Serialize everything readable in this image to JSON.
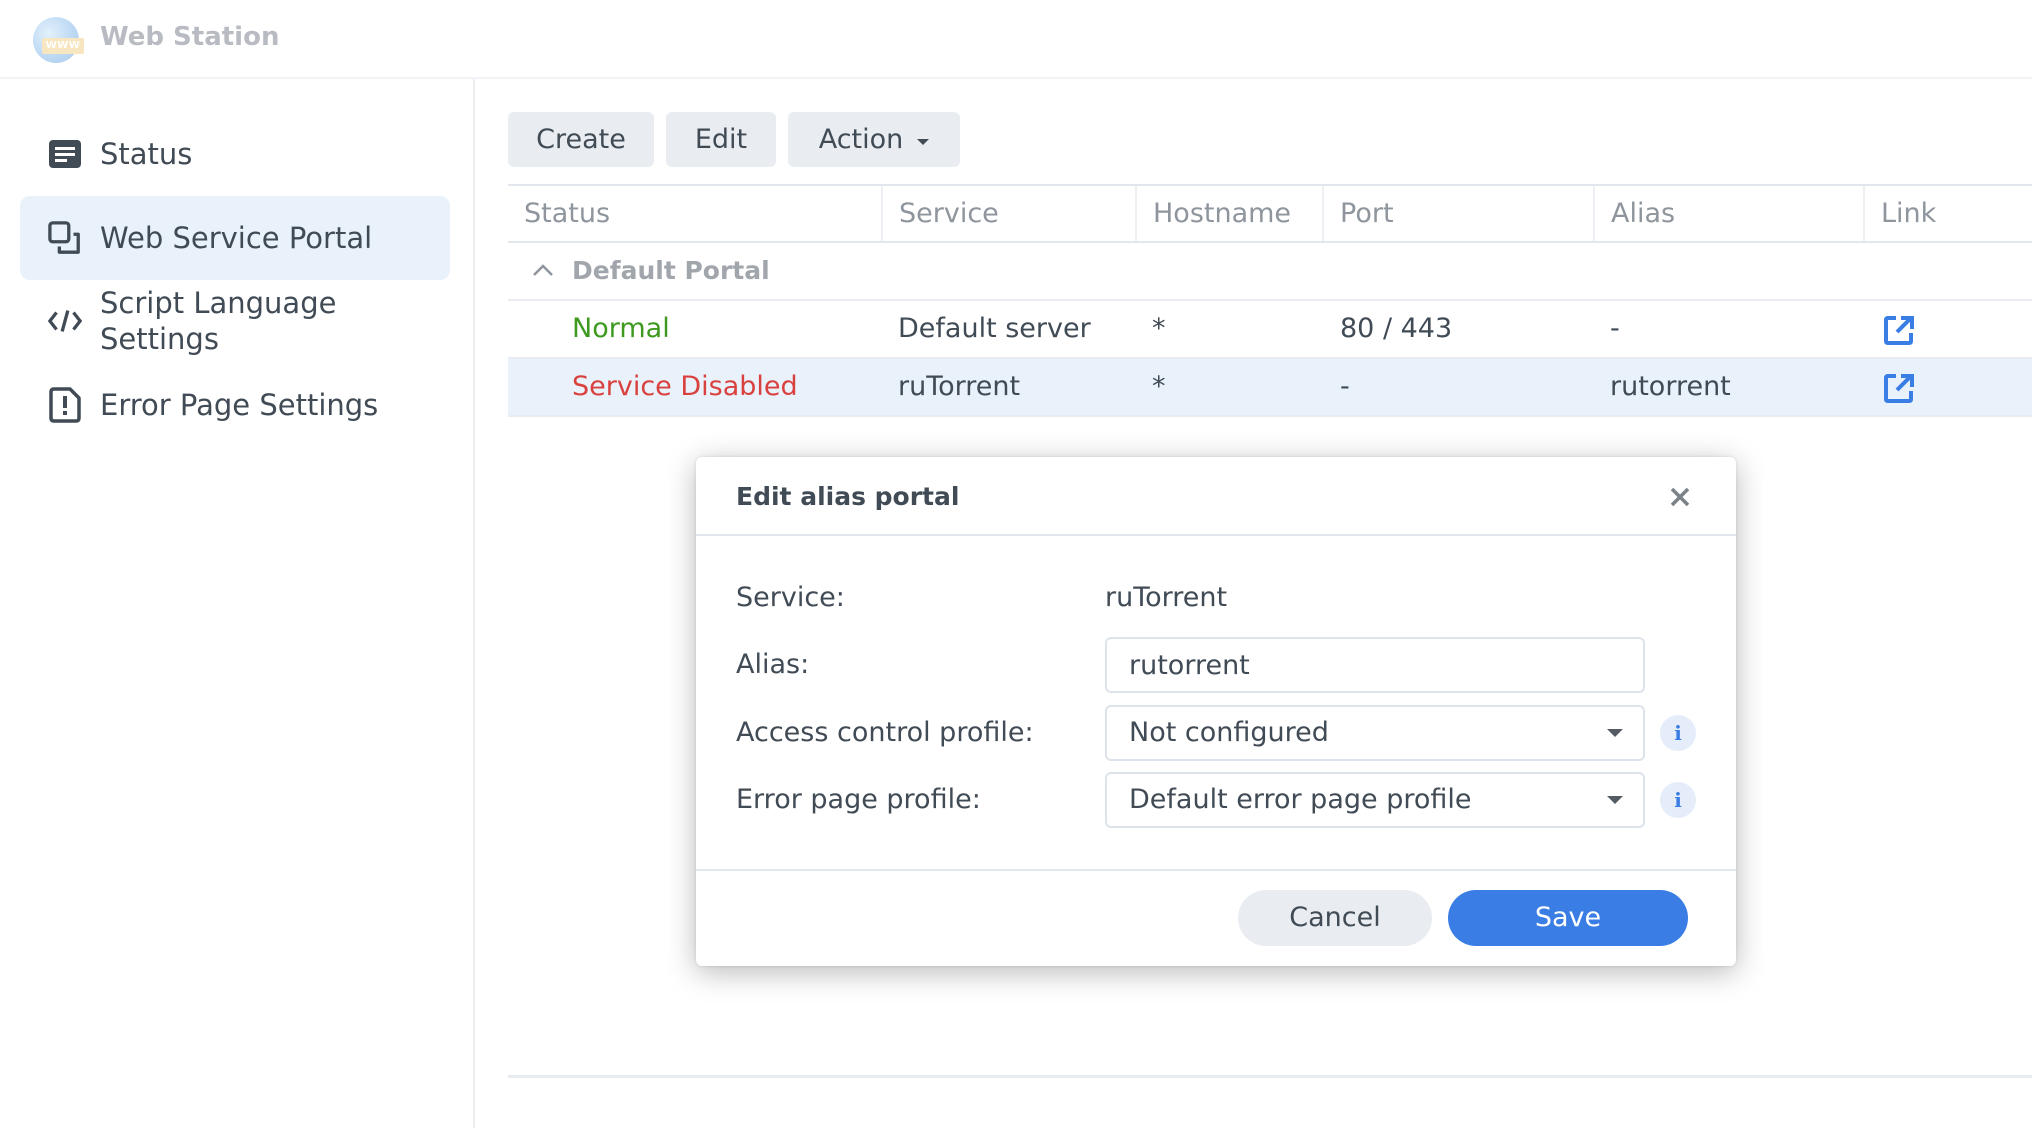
{
  "app": {
    "title": "Web Station",
    "logo_text": "WWW",
    "logo_icon": "web-station-globe-icon"
  },
  "sidebar": {
    "items": [
      {
        "label": "Status",
        "icon": "status-list-icon",
        "active": false
      },
      {
        "label": "Web Service Portal",
        "icon": "portal-windows-icon",
        "active": true
      },
      {
        "label": "Script Language Settings",
        "label_line1": "Script Language",
        "label_line2": "Settings",
        "icon": "code-icon",
        "active": false
      },
      {
        "label": "Error Page Settings",
        "icon": "error-document-icon",
        "active": false
      }
    ]
  },
  "toolbar": {
    "create_label": "Create",
    "edit_label": "Edit",
    "action_label": "Action"
  },
  "grid": {
    "columns": [
      "Status",
      "Service",
      "Hostname",
      "Port",
      "Alias",
      "Link"
    ],
    "groups": [
      {
        "label": "Default Portal",
        "expanded": true,
        "rows": [
          {
            "status": "Normal",
            "status_color": "#3d9a1f",
            "service": "Default server",
            "hostname": "*",
            "port": "80 / 443",
            "alias": "-",
            "link_icon": "external-link-icon",
            "selected": false
          },
          {
            "status": "Service Disabled",
            "status_color": "#d9413e",
            "service": "ruTorrent",
            "hostname": "*",
            "port": "-",
            "alias": "rutorrent",
            "link_icon": "external-link-icon",
            "selected": true
          }
        ]
      }
    ]
  },
  "dialog": {
    "title": "Edit alias portal",
    "fields": {
      "service_label": "Service:",
      "service_value": "ruTorrent",
      "alias_label": "Alias:",
      "alias_value": "rutorrent",
      "access_label": "Access control profile:",
      "access_value": "Not configured",
      "error_label": "Error page profile:",
      "error_value": "Default error page profile"
    },
    "info_glyph": "i",
    "cancel_label": "Cancel",
    "save_label": "Save"
  },
  "colors": {
    "accent": "#3a7de4",
    "selected_row": "#e9f1fb",
    "normal": "#3d9a1f",
    "disabled": "#d9413e"
  }
}
